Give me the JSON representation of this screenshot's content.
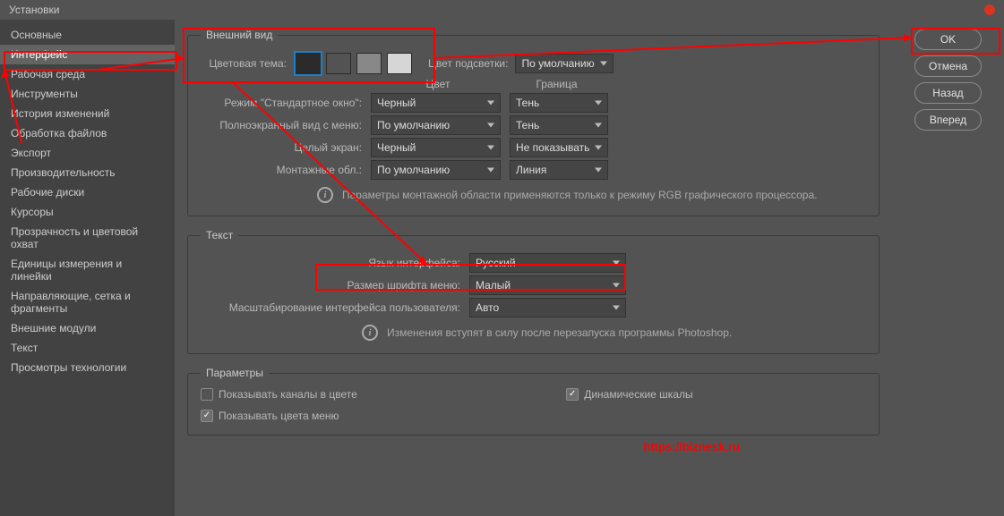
{
  "title": "Установки",
  "sidebar": {
    "items": [
      {
        "label": "Основные"
      },
      {
        "label": "Интерфейс"
      },
      {
        "label": "Рабочая среда"
      },
      {
        "label": "Инструменты"
      },
      {
        "label": "История изменений"
      },
      {
        "label": "Обработка файлов"
      },
      {
        "label": "Экспорт"
      },
      {
        "label": "Производительность"
      },
      {
        "label": "Рабочие диски"
      },
      {
        "label": "Курсоры"
      },
      {
        "label": "Прозрачность и цветовой охват"
      },
      {
        "label": "Единицы измерения и линейки"
      },
      {
        "label": "Направляющие, сетка и фрагменты"
      },
      {
        "label": "Внешние модули"
      },
      {
        "label": "Текст"
      },
      {
        "label": "Просмотры технологии"
      }
    ],
    "selected": 1
  },
  "buttons": {
    "ok": "OK",
    "cancel": "Отмена",
    "back": "Назад",
    "forward": "Вперед"
  },
  "appearance": {
    "legend": "Внешний вид",
    "theme_label": "Цветовая тема:",
    "swatches": [
      "#2b2b2b",
      "#535353",
      "#888888",
      "#d6d6d6"
    ],
    "highlight_label": "Цвет подсветки:",
    "highlight_value": "По умолчанию",
    "col_color": "Цвет",
    "col_border": "Граница",
    "rows": [
      {
        "label": "Режим \"Стандартное окно\":",
        "color": "Черный",
        "border": "Тень"
      },
      {
        "label": "Полноэкранный вид с меню:",
        "color": "По умолчанию",
        "border": "Тень"
      },
      {
        "label": "Целый экран:",
        "color": "Черный",
        "border": "Не показывать"
      },
      {
        "label": "Монтажные обл.:",
        "color": "По умолчанию",
        "border": "Линия"
      }
    ],
    "info": "Параметры монтажной области применяются только к режиму RGB графического процессора."
  },
  "text": {
    "legend": "Текст",
    "lang_label": "Язык интерфейса:",
    "lang_value": "Русский",
    "font_label": "Размер шрифта меню:",
    "font_value": "Малый",
    "scale_label": "Масштабирование интерфейса пользователя:",
    "scale_value": "Авто",
    "info": "Изменения вступят в силу после перезапуска программы Photoshop."
  },
  "params": {
    "legend": "Параметры",
    "show_channels": "Показывать каналы в цвете",
    "dynamic_scales": "Динамические шкалы",
    "show_menu_colors": "Показывать цвета меню"
  },
  "watermark": "https://biznesk.ru"
}
